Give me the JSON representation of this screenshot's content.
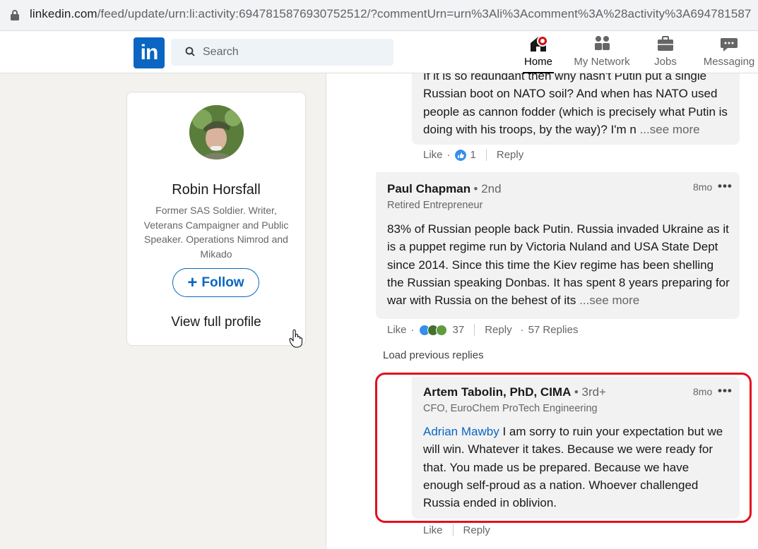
{
  "browser": {
    "url_host": "linkedin.com",
    "url_rest": "/feed/update/urn:li:activity:6947815876930752512/?commentUrn=urn%3Ali%3Acomment%3A%28activity%3A694781587"
  },
  "nav": {
    "logo_text": "in",
    "search_placeholder": "Search",
    "items": [
      {
        "label": "Home",
        "icon": "home-icon"
      },
      {
        "label": "My Network",
        "icon": "network-icon"
      },
      {
        "label": "Jobs",
        "icon": "briefcase-icon"
      },
      {
        "label": "Messaging",
        "icon": "message-icon"
      }
    ]
  },
  "profile": {
    "name": "Robin Horsfall",
    "headline": "Former SAS Soldier. Writer, Veterans Campaigner and Public Speaker. Operations Nimrod and Mikado",
    "follow_label": "Follow",
    "view_profile_label": "View full profile"
  },
  "comments": [
    {
      "text": "If it is so redundant then why hasn't Putin put a single Russian boot on NATO soil? And when has NATO used people as cannon fodder (which is precisely what Putin is doing with his troops, by the way)? I'm n",
      "see_more": "...see more",
      "like_label": "Like",
      "reaction_count": "1",
      "reply_label": "Reply"
    },
    {
      "author": "Paul Chapman",
      "degree": "• 2nd",
      "headline": "Retired Entrepreneur",
      "time": "8mo",
      "text": "83% of Russian people back Putin. Russia invaded Ukraine as it is a puppet regime run by Victoria Nuland and USA State Dept since 2014. Since this time the Kiev regime has been shelling the Russian speaking Donbas. It has spent 8 years preparing for war with Russia on the behest of its",
      "see_more": "...see more",
      "like_label": "Like",
      "reaction_count": "37",
      "reply_label": "Reply",
      "replies_label": "57 Replies"
    },
    {
      "author": "Artem Tabolin, PhD, CIMA",
      "degree": "• 3rd+",
      "headline": "CFO, EuroChem ProTech Engineering",
      "time": "8mo",
      "mention": "Adrian Mawby",
      "text": " I am sorry to ruin your expectation but we will win. Whatever it takes. Because we were ready for that. You made us be prepared. Because we have enough self-proud as a nation. Whoever challenged Russia ended in oblivion.",
      "like_label": "Like",
      "reply_label": "Reply"
    }
  ],
  "load_previous": "Load previous replies",
  "colors": {
    "brand": "#0a66c2",
    "highlight": "#e2101e",
    "notification": "#cc1016"
  }
}
